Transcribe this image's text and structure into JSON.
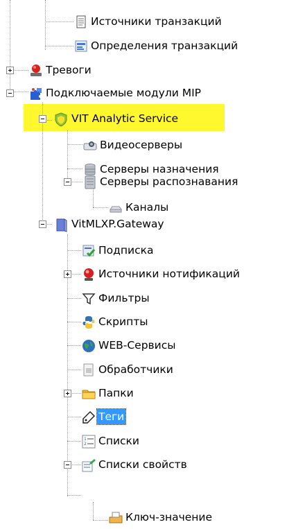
{
  "tree": {
    "nodes": [
      {
        "label": "Источники транзакций",
        "icon": "document-icon",
        "expander": "none"
      },
      {
        "label": "Определения транзакций",
        "icon": "transaction-definition-icon",
        "expander": "none"
      },
      {
        "label": "Тревоги",
        "icon": "alarm-siren-icon",
        "expander": "plus"
      },
      {
        "label": "Подключаемые модули MIP",
        "icon": "puzzle-plugin-icon",
        "expander": "minus"
      },
      {
        "label": "VIT Analytic Service",
        "icon": "shield-icon",
        "expander": "minus",
        "highlighted": true,
        "highlight_color": "#fff82e"
      },
      {
        "label": "Видеосерверы",
        "icon": "video-server-icon",
        "expander": "none"
      },
      {
        "label": "Серверы назначения",
        "icon": "database-server-icon",
        "expander": "none"
      },
      {
        "label": "Серверы распознавания",
        "icon": "recognition-server-icon",
        "expander": "minus"
      },
      {
        "label": "Каналы",
        "icon": "channel-drive-icon",
        "expander": "none"
      },
      {
        "label": "VitMLXP.Gateway",
        "icon": "gateway-book-icon",
        "expander": "minus"
      },
      {
        "label": "Подписка",
        "icon": "subscription-check-icon",
        "expander": "none"
      },
      {
        "label": "Источники нотификаций",
        "icon": "notification-source-icon",
        "expander": "plus"
      },
      {
        "label": "Фильтры",
        "icon": "filter-funnel-icon",
        "expander": "none"
      },
      {
        "label": "Скрипты",
        "icon": "python-script-icon",
        "expander": "none"
      },
      {
        "label": "WEB-Сервисы",
        "icon": "globe-icon",
        "expander": "none"
      },
      {
        "label": "Обработчики",
        "icon": "handler-document-icon",
        "expander": "none"
      },
      {
        "label": "Папки",
        "icon": "folder-icon",
        "expander": "plus"
      },
      {
        "label": "Теги",
        "icon": "tag-icon",
        "expander": "none",
        "selected": true,
        "selected_color": "#3399ff"
      },
      {
        "label": "Списки",
        "icon": "numbered-list-icon",
        "expander": "none"
      },
      {
        "label": "Списки свойств",
        "icon": "property-list-icon",
        "expander": "minus"
      },
      {
        "label": "Ключ-значение",
        "icon": "key-value-icon",
        "expander": "none"
      }
    ]
  }
}
